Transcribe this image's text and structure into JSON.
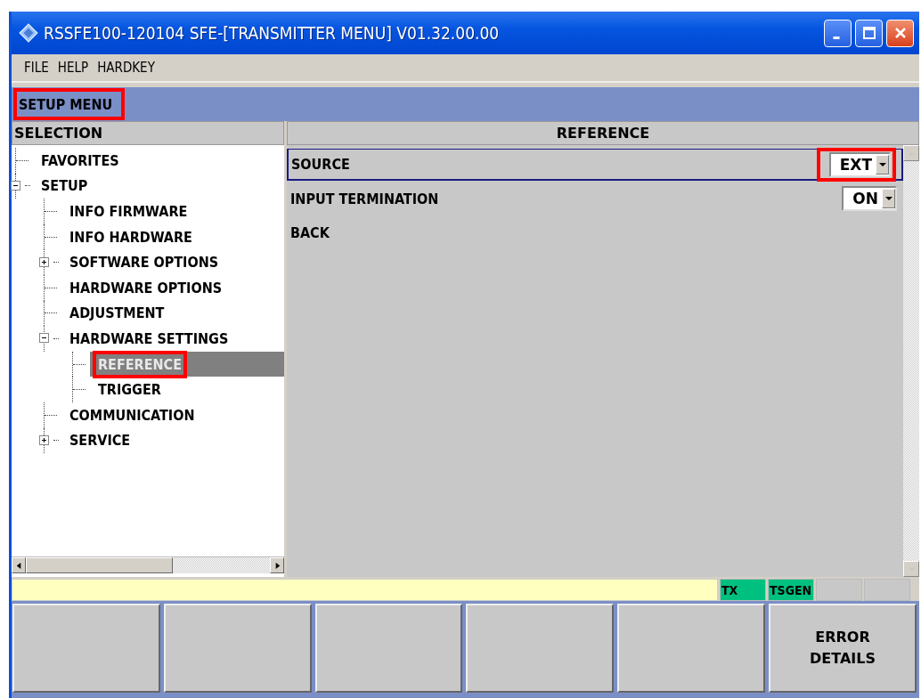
{
  "window": {
    "title": "RSSFE100-120104  SFE-[TRANSMITTER MENU]  V01.32.00.00"
  },
  "menu": [
    "FILE",
    "HELP",
    "HARDKEY"
  ],
  "header": {
    "title": "SETUP MENU",
    "highlighted": true
  },
  "selection": {
    "title": "SELECTION",
    "tree": [
      {
        "label": "FAVORITES",
        "selected": false,
        "highlighted": false
      },
      {
        "label": "SETUP",
        "selected": false,
        "highlighted": false,
        "expanded": true,
        "children": [
          {
            "label": "INFO FIRMWARE",
            "selected": false,
            "highlighted": false
          },
          {
            "label": "INFO HARDWARE",
            "selected": false,
            "highlighted": false
          },
          {
            "label": "SOFTWARE OPTIONS",
            "selected": false,
            "highlighted": false,
            "expanded": false
          },
          {
            "label": "HARDWARE OPTIONS",
            "selected": false,
            "highlighted": false
          },
          {
            "label": "ADJUSTMENT",
            "selected": false,
            "highlighted": false
          },
          {
            "label": "HARDWARE SETTINGS",
            "selected": false,
            "highlighted": false,
            "expanded": true,
            "children": [
              {
                "label": "REFERENCE",
                "selected": true,
                "highlighted": true
              },
              {
                "label": "TRIGGER",
                "selected": false,
                "highlighted": false
              }
            ]
          },
          {
            "label": "COMMUNICATION",
            "selected": false,
            "highlighted": false
          },
          {
            "label": "SERVICE",
            "selected": false,
            "highlighted": false,
            "expanded": false
          }
        ]
      }
    ]
  },
  "settings": {
    "title": "REFERENCE",
    "rows": [
      {
        "label": "SOURCE",
        "kind": "dropdown",
        "value": "EXT",
        "selected": true,
        "highlighted": true
      },
      {
        "label": "INPUT TERMINATION",
        "kind": "dropdown",
        "value": "ON",
        "selected": false,
        "highlighted": false
      },
      {
        "label": "BACK",
        "kind": "link",
        "selected": false,
        "highlighted": false
      }
    ]
  },
  "status_bar": {
    "cells": [
      {
        "label": "TX",
        "color": "#00c080"
      },
      {
        "label": "TSGEN",
        "color": "#00c080"
      },
      {},
      {}
    ]
  },
  "softkeys": [
    {
      "kind": "blank"
    },
    {
      "kind": "blank"
    },
    {
      "kind": "blank"
    },
    {
      "kind": "blank"
    },
    {
      "kind": "blank"
    },
    {
      "kind": "text",
      "label": "ERROR\nDETAILS"
    }
  ]
}
